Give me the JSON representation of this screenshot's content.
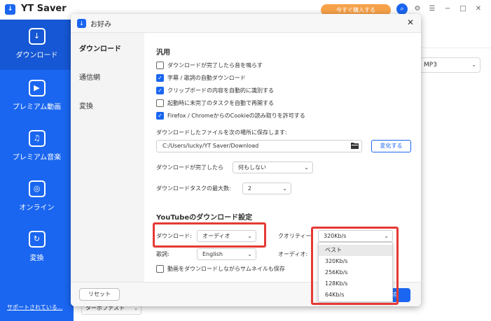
{
  "app": {
    "name": "YT Saver",
    "buy_label": "今すぐ購入する",
    "logo_glyph": "↓"
  },
  "sidebar": {
    "items": [
      {
        "label": "ダウンロード",
        "icon": "download-icon",
        "glyph": "↓"
      },
      {
        "label": "プレミアム動画",
        "icon": "play-icon",
        "glyph": "▶"
      },
      {
        "label": "プレミアム音楽",
        "icon": "music-note-icon",
        "glyph": "♫"
      },
      {
        "label": "オンライン",
        "icon": "globe-icon",
        "glyph": "◎"
      },
      {
        "label": "変換",
        "icon": "convert-icon",
        "glyph": "↻"
      }
    ],
    "support_link": "サポートされている..."
  },
  "background": {
    "format_select": "MP3",
    "speed_select": "ターボファスト"
  },
  "dialog": {
    "title": "お好み",
    "tabs": [
      "ダウンロード",
      "通信網",
      "変換"
    ],
    "general": {
      "heading": "汎用",
      "checkboxes": [
        {
          "label": "ダウンロードが完了したら音を鳴らす",
          "checked": false
        },
        {
          "label": "字幕 / 歌詞の自動ダウンロード",
          "checked": true
        },
        {
          "label": "クリップボードの内容を自動的に識別する",
          "checked": true
        },
        {
          "label": "起動時に未完了のタスクを自動で再開する",
          "checked": false
        },
        {
          "label": "Firefox / ChromeからのCookieの読み取りを許可する",
          "checked": true
        }
      ],
      "save_location_label": "ダウンロードしたファイルを次の場所に保存します:",
      "save_path": "C:/Users/lucky/YT Saver/Download",
      "change_button": "変化する",
      "after_download_label": "ダウンロードが完了したら",
      "after_download_value": "何もしない",
      "max_tasks_label": "ダウンロードタスクの最大数:",
      "max_tasks_value": "2"
    },
    "youtube": {
      "heading": "YouTubeのダウンロード設定",
      "download_label": "ダウンロード:",
      "download_value": "オーディオ",
      "quality_label": "クオリティー:",
      "quality_value": "320Kb/s",
      "lyrics_label": "歌詞:",
      "lyrics_value": "English",
      "audio_label": "オーディオ:",
      "thumbnail_checkbox": {
        "label": "動画をダウンロードしながらサムネイルも保存",
        "checked": false
      },
      "quality_options": [
        "ベスト",
        "320Kb/s",
        "256Kb/s",
        "128Kb/s",
        "64Kb/s"
      ],
      "highlighted_option": "ベスト"
    },
    "footer": {
      "reset_button": "リセット",
      "save_button": "保存"
    }
  },
  "colors": {
    "brand_blue": "#1a66f0",
    "highlight_red": "#e53935",
    "buy_orange": "#f7a24a"
  }
}
